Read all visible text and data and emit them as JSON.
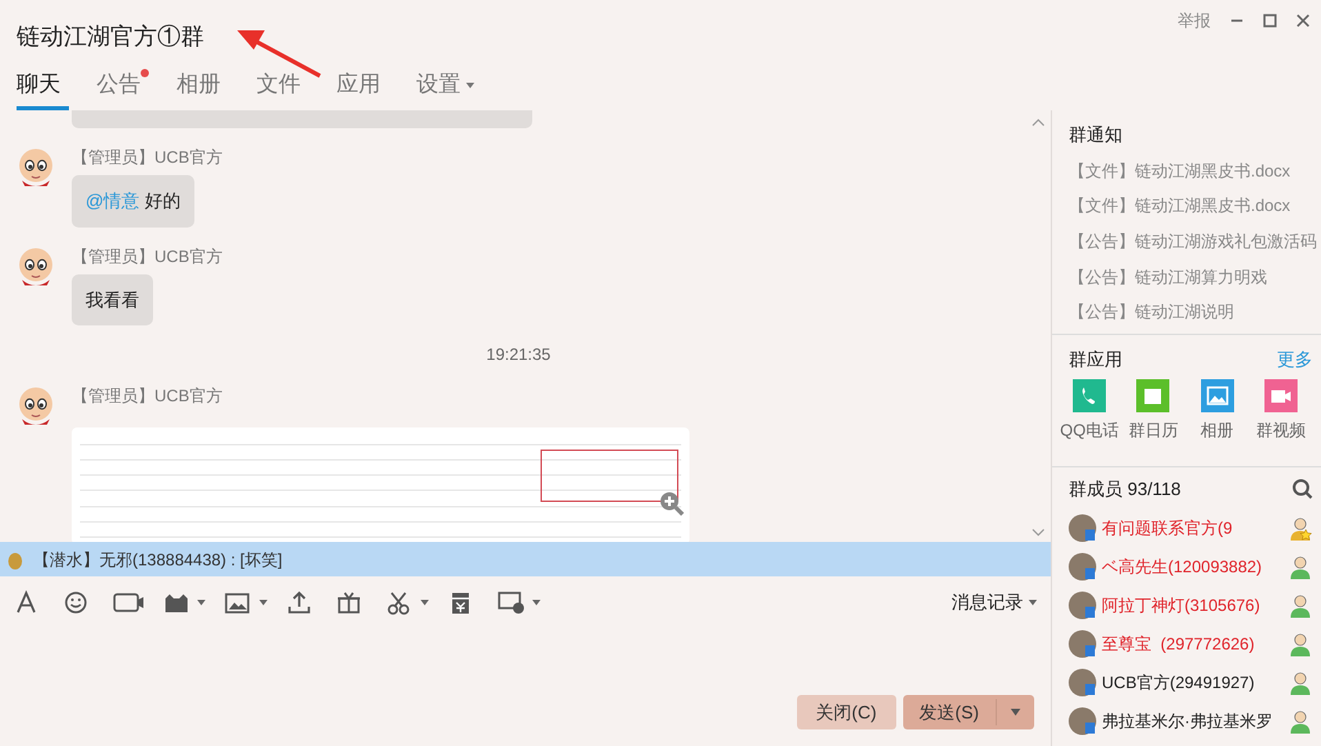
{
  "window": {
    "title": "链动江湖官方①群",
    "controls": [
      "举报"
    ]
  },
  "tabs": [
    {
      "label": "聊天",
      "selected": true,
      "dot": false,
      "menu": false
    },
    {
      "label": "公告",
      "selected": false,
      "dot": true,
      "menu": false
    },
    {
      "label": "相册",
      "selected": false,
      "dot": false,
      "menu": false
    },
    {
      "label": "文件",
      "selected": false,
      "dot": false,
      "menu": false
    },
    {
      "label": "应用",
      "selected": false,
      "dot": false,
      "menu": false
    },
    {
      "label": "设置",
      "selected": false,
      "dot": false,
      "menu": true
    }
  ],
  "messages": [
    {
      "kind": "cut"
    },
    {
      "kind": "text",
      "sender": "【管理员】UCB官方",
      "mention": "@情意",
      "text": "好的"
    },
    {
      "kind": "text",
      "sender": "【管理员】UCB官方",
      "text": "我看看"
    },
    {
      "kind": "time",
      "text": "19:21:35"
    },
    {
      "kind": "image",
      "sender": "【管理员】UCB官方"
    }
  ],
  "notice_bar": {
    "text": "【潜水】无邪(138884438) : [坏笑]"
  },
  "toolbar": {
    "history": "消息记录"
  },
  "buttons": [
    {
      "label": "关闭(C)",
      "kind": "plain"
    },
    {
      "label": "发送(S)",
      "kind": "split"
    }
  ],
  "sidebar": {
    "notice_title": "群通知",
    "notices": [
      {
        "tag": "【文件】",
        "text": "链动江湖黑皮书.docx"
      },
      {
        "tag": "【文件】",
        "text": "链动江湖黑皮书.docx"
      },
      {
        "tag": "【公告】",
        "text": "链动江湖游戏礼包激活码"
      },
      {
        "tag": "【公告】",
        "text": "链动江湖算力明戏"
      },
      {
        "tag": "【公告】",
        "text": "链动江湖说明"
      }
    ],
    "apps_title": "群应用",
    "more": "更多",
    "apps": [
      {
        "label": "QQ电话",
        "kind": "phone"
      },
      {
        "label": "群日历",
        "kind": "calendar"
      },
      {
        "label": "相册",
        "kind": "photo"
      },
      {
        "label": "群视频",
        "kind": "video"
      }
    ],
    "members_title": "群成员 93/118",
    "members": [
      {
        "name": "有问题联系官方(9",
        "color": "#e0242b",
        "owner": true
      },
      {
        "name": "ベ高先生(120093882)",
        "color": "#e0242b",
        "owner": false
      },
      {
        "name": "阿拉丁神灯(3105676)",
        "color": "#e0242b",
        "owner": false
      },
      {
        "name": "至尊宝  (297772626)",
        "color": "#e0242b",
        "owner": false
      },
      {
        "name": "UCB官方(29491927)",
        "color": "#222222",
        "owner": false
      },
      {
        "name": "弗拉基米尔·弗拉基米罗",
        "color": "#222222",
        "owner": false
      }
    ]
  }
}
